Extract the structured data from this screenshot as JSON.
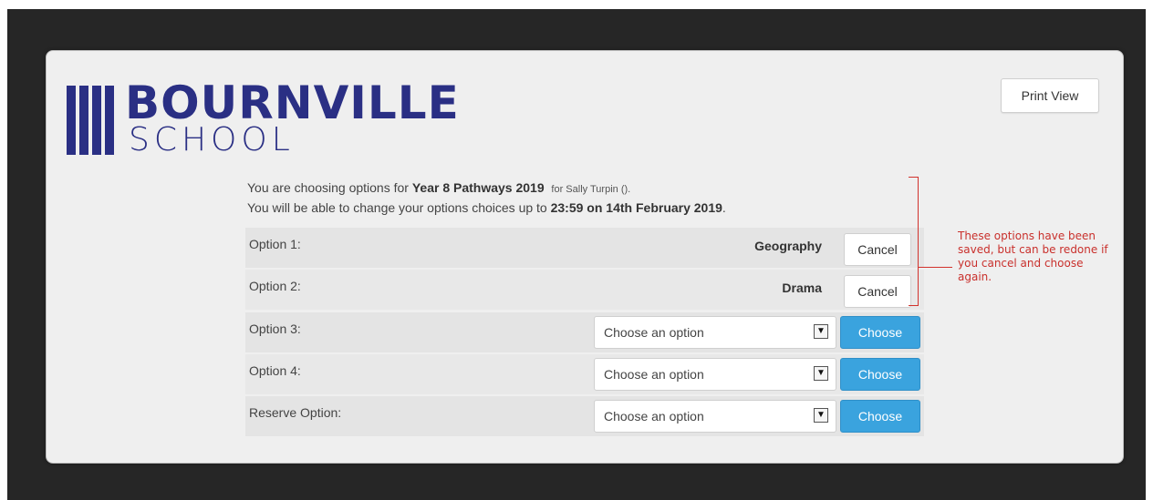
{
  "logo": {
    "word": "BOURNVILLE",
    "sub": "SCHOOL"
  },
  "toolbar": {
    "print_label": "Print View"
  },
  "info": {
    "line1_prefix": "You are choosing options for ",
    "program": "Year 8 Pathways 2019",
    "for_text": "for Sally Turpin ().",
    "line2_prefix": "You will be able to change your options choices up to ",
    "deadline": "23:59 on 14th February 2019",
    "line2_suffix": "."
  },
  "options": [
    {
      "label": "Option 1:",
      "chosen": "Geography",
      "action": "Cancel"
    },
    {
      "label": "Option 2:",
      "chosen": "Drama",
      "action": "Cancel"
    },
    {
      "label": "Option 3:",
      "placeholder": "Choose an option",
      "action": "Choose"
    },
    {
      "label": "Option 4:",
      "placeholder": "Choose an option",
      "action": "Choose"
    },
    {
      "label": "Reserve Option:",
      "placeholder": "Choose an option",
      "action": "Choose"
    }
  ],
  "annotation": "These options have been saved, but can be redone if you cancel and choose again.",
  "colors": {
    "brand": "#2a2f84",
    "accent": "#3aa3de",
    "annotation": "#c9302c"
  }
}
